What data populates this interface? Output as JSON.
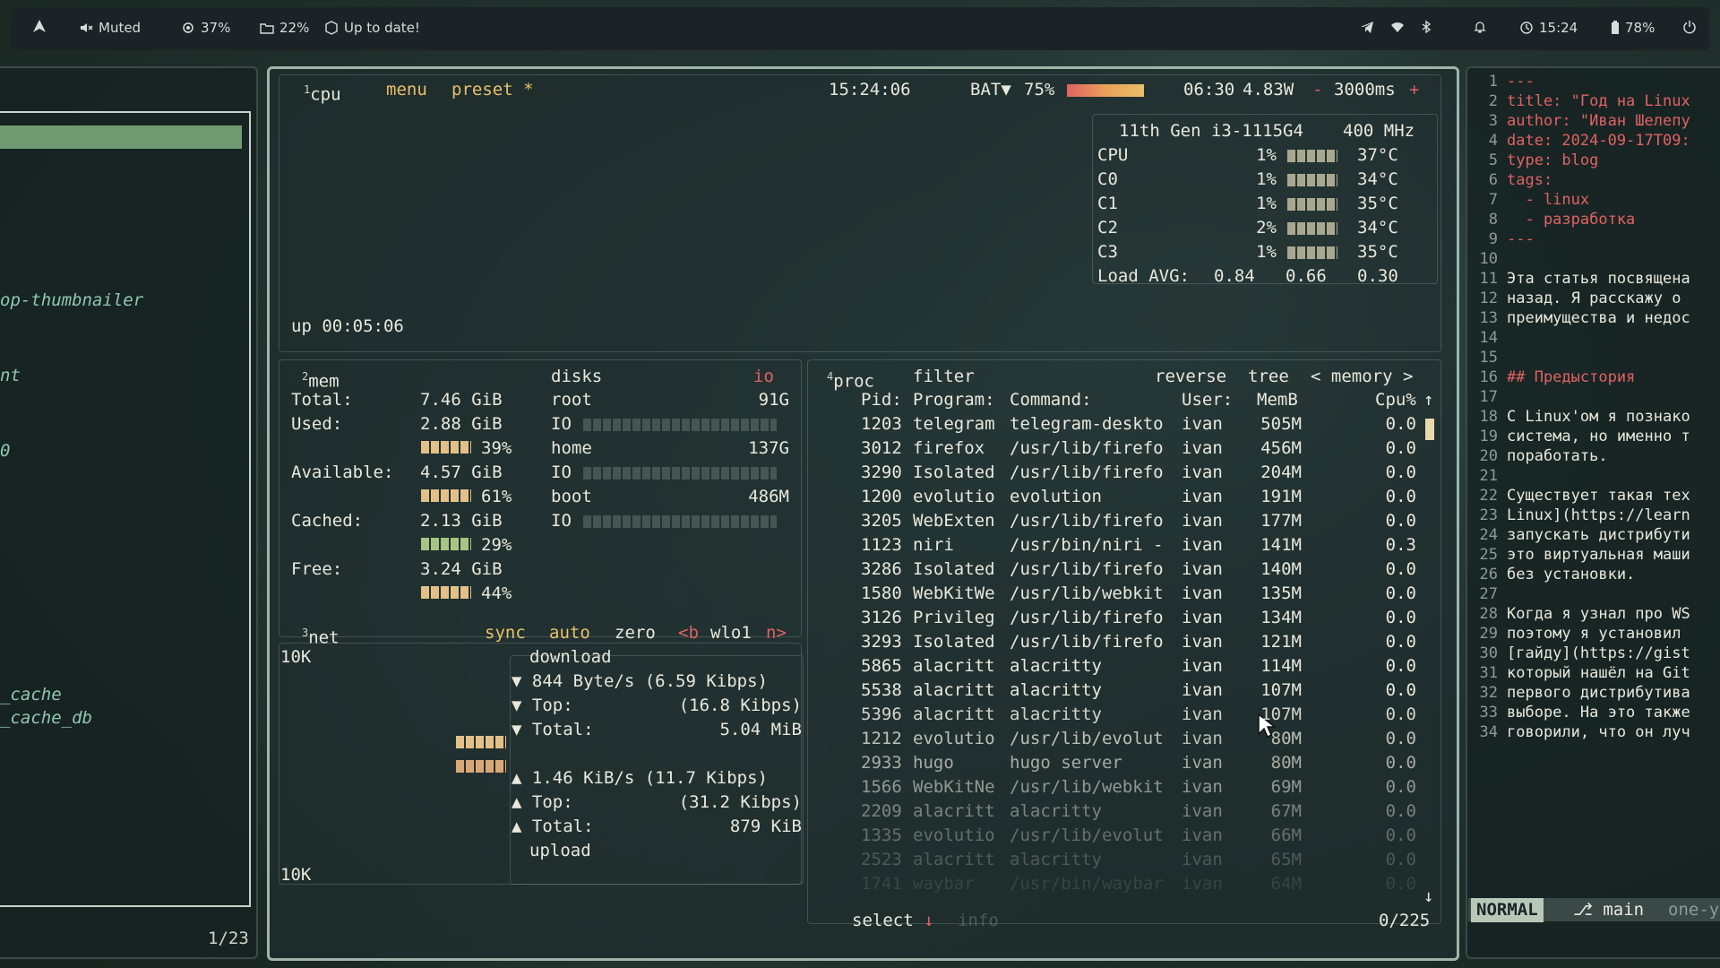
{
  "topbar": {
    "volume": "Muted",
    "cpu": "37%",
    "disk": "22%",
    "updates": "Up to date!",
    "time": "15:24",
    "battery": "78%"
  },
  "left_panel": {
    "items": [
      "op-thumbnailer",
      "nt",
      "0",
      "_cache",
      "_cache_db"
    ],
    "counter": "1/23"
  },
  "btop": {
    "cpu_tab_num": "1",
    "cpu_tab": "cpu",
    "menu": "menu",
    "preset": "preset *",
    "clock": "15:24:06",
    "bat_label": "BAT▼",
    "bat_pct": "75%",
    "bat_time": "06:30",
    "bat_watt": "4.83W",
    "dash": "-",
    "interval": "3000ms",
    "plus": "+",
    "uptime": "up 00:05:06",
    "cpu_model": "11th Gen i3-1115G4",
    "cpu_freq": "400 MHz",
    "cores": [
      {
        "name": "CPU",
        "pct": "1%",
        "temp": "37°C"
      },
      {
        "name": "C0",
        "pct": "1%",
        "temp": "34°C"
      },
      {
        "name": "C1",
        "pct": "1%",
        "temp": "35°C"
      },
      {
        "name": "C2",
        "pct": "2%",
        "temp": "34°C"
      },
      {
        "name": "C3",
        "pct": "1%",
        "temp": "35°C"
      }
    ],
    "load_label": "Load AVG:",
    "load": [
      "0.84",
      "0.66",
      "0.30"
    ],
    "mem": {
      "num": "2",
      "title": "mem",
      "total_label": "Total:",
      "total": "7.46 GiB",
      "used_label": "Used:",
      "used": "2.88 GiB",
      "used_pct": "39%",
      "avail_label": "Available:",
      "avail": "4.57 GiB",
      "avail_pct": "61%",
      "cached_label": "Cached:",
      "cached": "2.13 GiB",
      "cached_pct": "29%",
      "free_label": "Free:",
      "free": "3.24 GiB",
      "free_pct": "44%"
    },
    "disks": {
      "title": "disks",
      "io": "io",
      "io_label": "IO",
      "list": [
        {
          "name": "root",
          "size": "91G"
        },
        {
          "name": "home",
          "size": "137G"
        },
        {
          "name": "boot",
          "size": "486M"
        }
      ]
    },
    "net": {
      "num": "3",
      "title": "net",
      "sync": "sync",
      "auto": "auto",
      "zero": "zero",
      "b": "<b",
      "iface": "wlo1",
      "n": "n>",
      "scale_top": "10K",
      "scale_bottom": "10K",
      "download": "download",
      "dl_rate": "844 Byte/s (6.59 Kibps)",
      "dl_top_label": "Top:",
      "dl_top": "(16.8 Kibps)",
      "dl_total_label": "Total:",
      "dl_total": "5.04 MiB",
      "ul_rate": "1.46 KiB/s (11.7 Kibps)",
      "ul_top_label": "Top:",
      "ul_top": "(31.2 Kibps)",
      "ul_total_label": "Total:",
      "ul_total": "879 KiB",
      "upload": "upload"
    },
    "proc": {
      "num": "4",
      "title": "proc",
      "filter": "filter",
      "reverse": "reverse",
      "tree": "tree",
      "sort": "< memory >",
      "headers": {
        "pid": "Pid:",
        "program": "Program:",
        "command": "Command:",
        "user": "User:",
        "mem": "MemB",
        "cpu": "Cpu%"
      },
      "rows": [
        {
          "pid": "1203",
          "program": "telegram",
          "command": "telegram-deskto",
          "user": "ivan",
          "mem": "505M",
          "cpu": "0.0"
        },
        {
          "pid": "3012",
          "program": "firefox",
          "command": "/usr/lib/firefo",
          "user": "ivan",
          "mem": "456M",
          "cpu": "0.0"
        },
        {
          "pid": "3290",
          "program": "Isolated",
          "command": "/usr/lib/firefo",
          "user": "ivan",
          "mem": "204M",
          "cpu": "0.0"
        },
        {
          "pid": "1200",
          "program": "evolutio",
          "command": "evolution",
          "user": "ivan",
          "mem": "191M",
          "cpu": "0.0"
        },
        {
          "pid": "3205",
          "program": "WebExten",
          "command": "/usr/lib/firefo",
          "user": "ivan",
          "mem": "177M",
          "cpu": "0.0"
        },
        {
          "pid": "1123",
          "program": "niri",
          "command": "/usr/bin/niri -",
          "user": "ivan",
          "mem": "141M",
          "cpu": "0.3"
        },
        {
          "pid": "3286",
          "program": "Isolated",
          "command": "/usr/lib/firefo",
          "user": "ivan",
          "mem": "140M",
          "cpu": "0.0"
        },
        {
          "pid": "1580",
          "program": "WebKitWe",
          "command": "/usr/lib/webkit",
          "user": "ivan",
          "mem": "135M",
          "cpu": "0.0"
        },
        {
          "pid": "3126",
          "program": "Privileg",
          "command": "/usr/lib/firefo",
          "user": "ivan",
          "mem": "134M",
          "cpu": "0.0"
        },
        {
          "pid": "3293",
          "program": "Isolated",
          "command": "/usr/lib/firefo",
          "user": "ivan",
          "mem": "121M",
          "cpu": "0.0"
        },
        {
          "pid": "5865",
          "program": "alacritt",
          "command": "alacritty",
          "user": "ivan",
          "mem": "114M",
          "cpu": "0.0"
        },
        {
          "pid": "5538",
          "program": "alacritt",
          "command": "alacritty",
          "user": "ivan",
          "mem": "107M",
          "cpu": "0.0"
        },
        {
          "pid": "5396",
          "program": "alacritt",
          "command": "alacritty",
          "user": "ivan",
          "mem": "107M",
          "cpu": "0.0"
        },
        {
          "pid": "1212",
          "program": "evolutio",
          "command": "/usr/lib/evolut",
          "user": "ivan",
          "mem": "80M",
          "cpu": "0.0"
        },
        {
          "pid": "2933",
          "program": "hugo",
          "command": "hugo server",
          "user": "ivan",
          "mem": "80M",
          "cpu": "0.0"
        },
        {
          "pid": "1566",
          "program": "WebKitNe",
          "command": "/usr/lib/webkit",
          "user": "ivan",
          "mem": "69M",
          "cpu": "0.0"
        },
        {
          "pid": "2209",
          "program": "alacritt",
          "command": "alacritty",
          "user": "ivan",
          "mem": "67M",
          "cpu": "0.0"
        },
        {
          "pid": "1335",
          "program": "evolutio",
          "command": "/usr/lib/evolut",
          "user": "ivan",
          "mem": "66M",
          "cpu": "0.0"
        },
        {
          "pid": "2523",
          "program": "alacritt",
          "command": "alacritty",
          "user": "ivan",
          "mem": "65M",
          "cpu": "0.0"
        },
        {
          "pid": "1741",
          "program": "waybar",
          "command": "/usr/bin/waybar",
          "user": "ivan",
          "mem": "64M",
          "cpu": "0.0"
        }
      ],
      "select": "select",
      "info": "info",
      "count": "0/225"
    }
  },
  "editor": {
    "lines": [
      {
        "n": "1",
        "text": "---",
        "cls": "red"
      },
      {
        "n": "2",
        "text": "title: \"Год на Linux",
        "cls": "red"
      },
      {
        "n": "3",
        "text": "author: \"Иван Шелепу",
        "cls": "red"
      },
      {
        "n": "4",
        "text": "date: 2024-09-17T09:",
        "cls": "red"
      },
      {
        "n": "5",
        "text": "type: blog",
        "cls": "red"
      },
      {
        "n": "6",
        "text": "tags:",
        "cls": "red"
      },
      {
        "n": "7",
        "text": "  - linux",
        "cls": "red"
      },
      {
        "n": "8",
        "text": "  - разработка",
        "cls": "red"
      },
      {
        "n": "9",
        "text": "---",
        "cls": "red"
      },
      {
        "n": "10",
        "text": "",
        "cls": ""
      },
      {
        "n": "11",
        "text": "Эта статья посвящена",
        "cls": ""
      },
      {
        "n": "12",
        "text": "назад. Я расскажу о",
        "cls": ""
      },
      {
        "n": "13",
        "text": "преимущества и недос",
        "cls": ""
      },
      {
        "n": "14",
        "text": "",
        "cls": ""
      },
      {
        "n": "15",
        "text": "",
        "cls": ""
      },
      {
        "n": "16",
        "text": "## Предыстория",
        "cls": "red"
      },
      {
        "n": "17",
        "text": "",
        "cls": ""
      },
      {
        "n": "18",
        "text": "С Linux'ом я познако",
        "cls": ""
      },
      {
        "n": "19",
        "text": "система, но именно т",
        "cls": ""
      },
      {
        "n": "20",
        "text": "поработать.",
        "cls": ""
      },
      {
        "n": "21",
        "text": "",
        "cls": ""
      },
      {
        "n": "22",
        "text": "Существует такая тех",
        "cls": ""
      },
      {
        "n": "23",
        "text": "Linux](https://learn",
        "cls": ""
      },
      {
        "n": "24",
        "text": "запускать дистрибути",
        "cls": ""
      },
      {
        "n": "25",
        "text": "это виртуальная маши",
        "cls": ""
      },
      {
        "n": "26",
        "text": "без установки.",
        "cls": ""
      },
      {
        "n": "27",
        "text": "",
        "cls": ""
      },
      {
        "n": "28",
        "text": "Когда я узнал про WS",
        "cls": ""
      },
      {
        "n": "29",
        "text": "поэтому я установил",
        "cls": ""
      },
      {
        "n": "30",
        "text": "[гайду](https://gist",
        "cls": ""
      },
      {
        "n": "31",
        "text": "который нашёл на Git",
        "cls": ""
      },
      {
        "n": "32",
        "text": "первого дистрибутива",
        "cls": ""
      },
      {
        "n": "33",
        "text": "выборе. На это также",
        "cls": ""
      },
      {
        "n": "34",
        "text": "говорили, что он луч",
        "cls": ""
      }
    ],
    "mode": "NORMAL",
    "branch": "main",
    "file": "one-y"
  },
  "colors": {
    "accent_red": "#e06262",
    "btop_border": "#9fb5aa",
    "mem_bar": "#e2c088",
    "topbar_bg": "#1b2326"
  }
}
